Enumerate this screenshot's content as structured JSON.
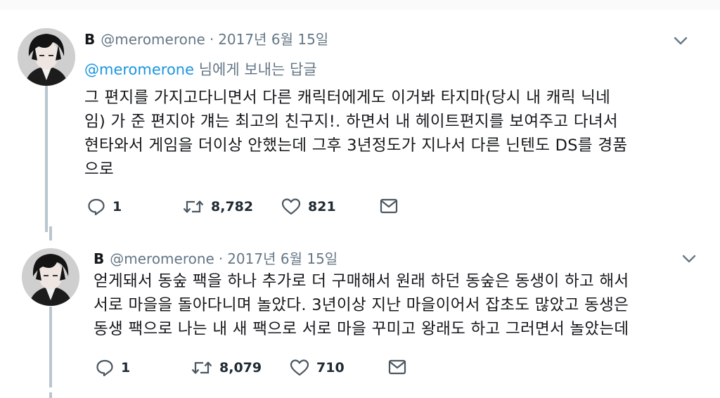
{
  "tweets": [
    {
      "display_name": "B",
      "handle": "@meromerone",
      "separator": "·",
      "date": "2017년 6월 15일",
      "reply_mention": "@meromerone",
      "reply_suffix": "님에게 보내는 답글",
      "lines": [
        "그 편지를 가지고다니면서 다른 캐릭터에게도 이거봐 타지마(당시 내 캐릭 닉네",
        "임) 가 준 편지야 걔는 최고의 친구지!. 하면서 내 헤이트편지를 보여주고 다녀서",
        "현타와서 게임을 더이상 안했는데 그후 3년정도가 지나서 다른 닌텐도 DS를 경품",
        "으로"
      ],
      "replies": "1",
      "retweets": "8,782",
      "likes": "821"
    },
    {
      "display_name": "B",
      "handle": "@meromerone",
      "separator": "·",
      "date": "2017년 6월 15일",
      "lines": [
        "얻게돼서 동숲 팩을 하나 추가로 더 구매해서 원래 하던 동숲은 동생이 하고 해서",
        "서로 마을을 돌아다니며 놀았다. 3년이상 지난 마을이어서 잡초도 많았고 동생은",
        "동생 팩으로 나는 내 새 팩으로 서로 마을 꾸미고 왕래도 하고 그러면서 놀았는데"
      ],
      "replies": "1",
      "retweets": "8,079",
      "likes": "710"
    }
  ],
  "icons": [
    "avatar",
    "chevron-down-icon",
    "reply-icon",
    "retweet-icon",
    "like-icon",
    "direct-message-icon"
  ]
}
